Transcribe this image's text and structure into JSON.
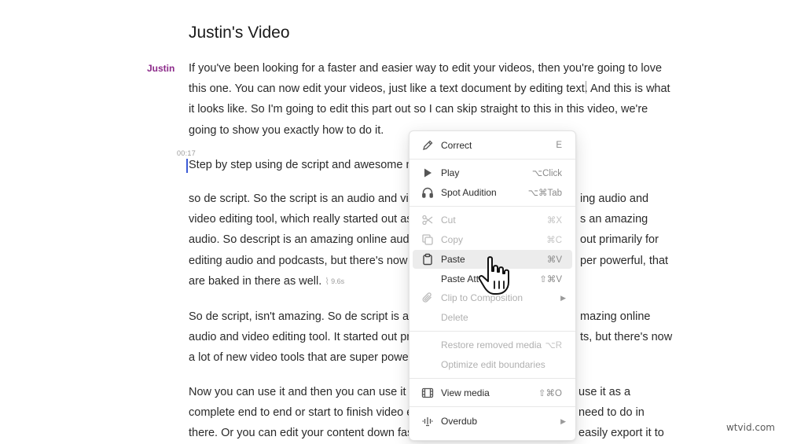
{
  "document": {
    "title": "Justin's Video",
    "speaker": "Justin",
    "timestamp": "00:17",
    "gap_label": "9.6s",
    "paragraphs": [
      "If you've been looking for a faster and easier way to edit your videos, then you're going to love this one. You can now edit your videos, just like a text document by editing text. And this is what it looks like. So I'm going to edit this part out so I can skip straight to this in this video, we're going to show you exactly how to do it.",
      "Step by step using de script and awesome n",
      "so de script. So the script is an audio and vid",
      "So de script, isn't amazing. So de script is an",
      "Now you can use it and then you can use it a"
    ],
    "para3_lines": [
      "so de script. So the script is an audio and vid",
      "video editing tool, which really started out as",
      "audio. So descript is an amazing online audio",
      "editing audio and podcasts, but there's now",
      "are baked in there as well."
    ],
    "para3_right": [
      "ing audio and",
      "s an amazing",
      "out primarily for",
      "per powerful, that"
    ],
    "para4_lines": [
      "So de script, isn't amazing. So de script is an",
      "audio and video editing tool. It started out pr",
      "a lot of new video tools that are super power"
    ],
    "para4_right": [
      "mazing online",
      "ts, but there's now"
    ],
    "para5_lines": [
      "Now you can use it and then you can use it a",
      "complete end to end or start to finish video e",
      "there. Or you can edit your content down fas"
    ],
    "para5_right": [
      "use it as a",
      "need to do in",
      "easily export it to"
    ]
  },
  "context_menu": {
    "items": [
      {
        "label": "Correct",
        "shortcut": "E",
        "icon": "pencil-icon",
        "enabled": true
      },
      {
        "label": "Play",
        "shortcut": "⌥Click",
        "icon": "play-icon",
        "enabled": true
      },
      {
        "label": "Spot Audition",
        "shortcut": "⌥⌘Tab",
        "icon": "headphones-icon",
        "enabled": true
      },
      {
        "label": "Cut",
        "shortcut": "⌘X",
        "icon": "scissors-icon",
        "enabled": false
      },
      {
        "label": "Copy",
        "shortcut": "⌘C",
        "icon": "copy-icon",
        "enabled": false
      },
      {
        "label": "Paste",
        "shortcut": "⌘V",
        "icon": "clipboard-icon",
        "enabled": true,
        "highlighted": true
      },
      {
        "label": "Paste Att",
        "shortcut": "⇧⌘V",
        "icon": "",
        "enabled": true
      },
      {
        "label": "Clip to Composition",
        "shortcut": "",
        "icon": "paperclip-icon",
        "enabled": false,
        "submenu": true
      },
      {
        "label": "Delete",
        "shortcut": "",
        "icon": "",
        "enabled": false
      },
      {
        "label": "Restore removed media",
        "shortcut": "⌥R",
        "icon": "",
        "enabled": false
      },
      {
        "label": "Optimize edit boundaries",
        "shortcut": "",
        "icon": "",
        "enabled": false
      },
      {
        "label": "View media",
        "shortcut": "⇧⌘O",
        "icon": "film-icon",
        "enabled": true
      },
      {
        "label": "Overdub",
        "shortcut": "",
        "icon": "overdub-icon",
        "enabled": true,
        "submenu": true
      }
    ]
  },
  "watermark": "wtvid.com",
  "colors": {
    "speaker": "#8c2a8a",
    "cursor": "#3c5bd6",
    "highlight": "#ececec"
  }
}
